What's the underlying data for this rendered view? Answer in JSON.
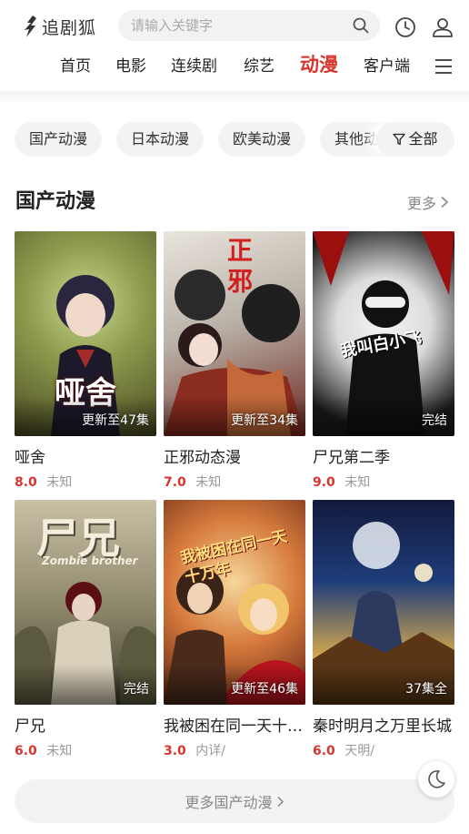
{
  "header": {
    "logo_text": "追剧狐",
    "search_placeholder": "请输入关键字"
  },
  "nav": {
    "items": [
      {
        "label": "首页"
      },
      {
        "label": "电影"
      },
      {
        "label": "连续剧"
      },
      {
        "label": "综艺"
      },
      {
        "label": "动漫",
        "active": true
      },
      {
        "label": "客户端"
      }
    ]
  },
  "filters": {
    "chips": [
      "国产动漫",
      "日本动漫",
      "欧美动漫",
      "其他动漫"
    ],
    "all_label": "全部"
  },
  "section": {
    "title": "国产动漫",
    "more_label": "更多"
  },
  "cards": [
    {
      "title": "哑舍",
      "score": "8.0",
      "info": "未知",
      "status": "更新至47集",
      "poster_text": "哑舍"
    },
    {
      "title": "正邪动态漫",
      "score": "7.0",
      "info": "未知",
      "status": "更新至34集",
      "poster_text": "正邪"
    },
    {
      "title": "尸兄第二季",
      "score": "9.0",
      "info": "未知",
      "status": "完结",
      "poster_text": "我叫白小飞"
    },
    {
      "title": "尸兄",
      "score": "6.0",
      "info": "未知",
      "status": "完结",
      "poster_text": "尸兄",
      "poster_sub": "Zombie brother"
    },
    {
      "title": "我被困在同一天十万年",
      "score": "3.0",
      "info": "内详/",
      "status": "更新至46集",
      "poster_text": "我被困在同一天十万年"
    },
    {
      "title": "秦时明月之万里长城",
      "score": "6.0",
      "info": "天明/",
      "status": "37集全",
      "poster_text": ""
    }
  ],
  "footer": {
    "more_button": "更多国产动漫"
  },
  "colors": {
    "accent": "#d8352f",
    "muted": "#999999",
    "chip_bg": "#f3f3f3"
  },
  "icons": {
    "search": "search-icon",
    "history": "clock-icon",
    "user": "user-icon",
    "menu": "menu-icon",
    "filter": "filter-icon",
    "theme": "moon-icon"
  }
}
